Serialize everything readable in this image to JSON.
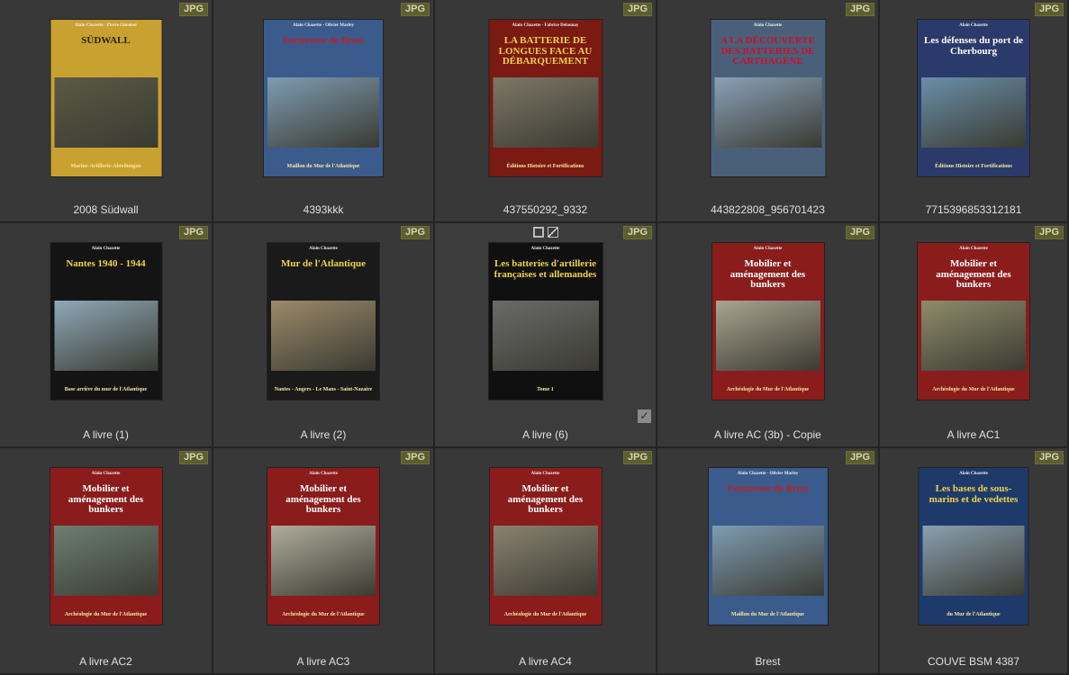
{
  "badge_text": "JPG",
  "items": [
    {
      "label": "2008 Südwall",
      "w": 123,
      "bg": "#c9a131",
      "title": "SÜDWALL",
      "sub": "Marine-Artillerie-Abteilungen",
      "top": "Alain Chazette - Pierre Giménez",
      "tc": "#2a1e05",
      "img": "#5a5a45"
    },
    {
      "label": "4393kkk",
      "w": 132,
      "bg": "#3a5b8c",
      "title": "Forteresse de Brest",
      "sub": "Maillon du Mur de l'Atlantique",
      "top": "Alain Chazette - Olivier Marley",
      "tc": "#c41e1e",
      "img": "#7e9cb2"
    },
    {
      "label": "437550292_9332",
      "w": 125,
      "bg": "#7a1a12",
      "title": "LA BATTERIE DE LONGUES FACE AU DÉBARQUEMENT",
      "sub": "Éditions Histoire et Fortifications",
      "top": "Alain Chazette - Fabrice Delaunay",
      "tc": "#f1d24a",
      "img": "#7d7766"
    },
    {
      "label": "443822808_956701423",
      "w": 127,
      "bg": "#4a607a",
      "title": "A LA DÉCOUVERTE DES BATTERIES DE CARTHAGÈNE",
      "sub": "",
      "top": "Alain Chazette",
      "tc": "#c8102e",
      "img": "#8aa1b8"
    },
    {
      "label": "7715396853312181",
      "w": 124,
      "bg": "#2a3a6a",
      "title": "Les défenses du port de Cherbourg",
      "sub": "Éditions Histoire et Fortifications",
      "top": "Alain Chazette",
      "tc": "#ffffff",
      "img": "#6a8fa8"
    },
    {
      "label": "A livre (1)",
      "w": 123,
      "bg": "#141414",
      "title": "Nantes 1940 - 1944",
      "sub": "Base arrière du mur de l'Atlantique",
      "top": "Alain Chazette",
      "tc": "#f1d24a",
      "img": "#8fa9b8"
    },
    {
      "label": "A livre (2)",
      "w": 124,
      "bg": "#1a1a1a",
      "title": "Mur de l'Atlantique",
      "sub": "Nantes - Angers - Le Mans - Saint-Nazaire",
      "top": "Alain Chazette",
      "tc": "#f1d24a",
      "img": "#9c8a6a"
    },
    {
      "label": "A livre (6)",
      "w": 126,
      "bg": "#101010",
      "title": "Les batteries d'artillerie françaises et allemandes",
      "sub": "Tome 1",
      "top": "Alain Chazette",
      "tc": "#f1d24a",
      "img": "#6a6a6a"
    },
    {
      "label": "A livre AC  (3b) - Copie",
      "w": 124,
      "bg": "#8a1c1c",
      "title": "Mobilier et aménagement des bunkers",
      "sub": "Archéologie du Mur de l'Atlantique",
      "top": "Alain Chazette",
      "tc": "#ffffff",
      "img": "#aaa490"
    },
    {
      "label": "A livre AC1",
      "w": 124,
      "bg": "#8a1c1c",
      "title": "Mobilier et aménagement des bunkers",
      "sub": "Archéologie du Mur de l'Atlantique",
      "top": "Alain Chazette",
      "tc": "#ffffff",
      "img": "#8e8c6a"
    },
    {
      "label": "A livre AC2",
      "w": 124,
      "bg": "#8a1c1c",
      "title": "Mobilier et aménagement des bunkers",
      "sub": "Archéologie du Mur de l'Atlantique",
      "top": "Alain Chazette",
      "tc": "#ffffff",
      "img": "#6c7f72"
    },
    {
      "label": "A livre AC3",
      "w": 124,
      "bg": "#8a1c1c",
      "title": "Mobilier et aménagement des bunkers",
      "sub": "Archéologie du Mur de l'Atlantique",
      "top": "Alain Chazette",
      "tc": "#ffffff",
      "img": "#b0ad9c"
    },
    {
      "label": "A livre AC4",
      "w": 124,
      "bg": "#8a1c1c",
      "title": "Mobilier et aménagement des bunkers",
      "sub": "Archéologie du Mur de l'Atlantique",
      "top": "Alain Chazette",
      "tc": "#ffffff",
      "img": "#8a8270"
    },
    {
      "label": "Brest",
      "w": 132,
      "bg": "#3a5b8c",
      "title": "Forteresse de Brest",
      "sub": "Maillon du Mur de l'Atlantique",
      "top": "Alain Chazette - Olivier Marley",
      "tc": "#c41e1e",
      "img": "#7e9cb2"
    },
    {
      "label": "COUVE BSM 4387",
      "w": 121,
      "bg": "#1e3a6a",
      "title": "Les bases de sous-marins et de vedettes",
      "sub": "du Mur de l'Atlantique",
      "top": "Alain Chazette",
      "tc": "#f1d24a",
      "img": "#8aa0b0"
    }
  ],
  "selected_index": 7
}
